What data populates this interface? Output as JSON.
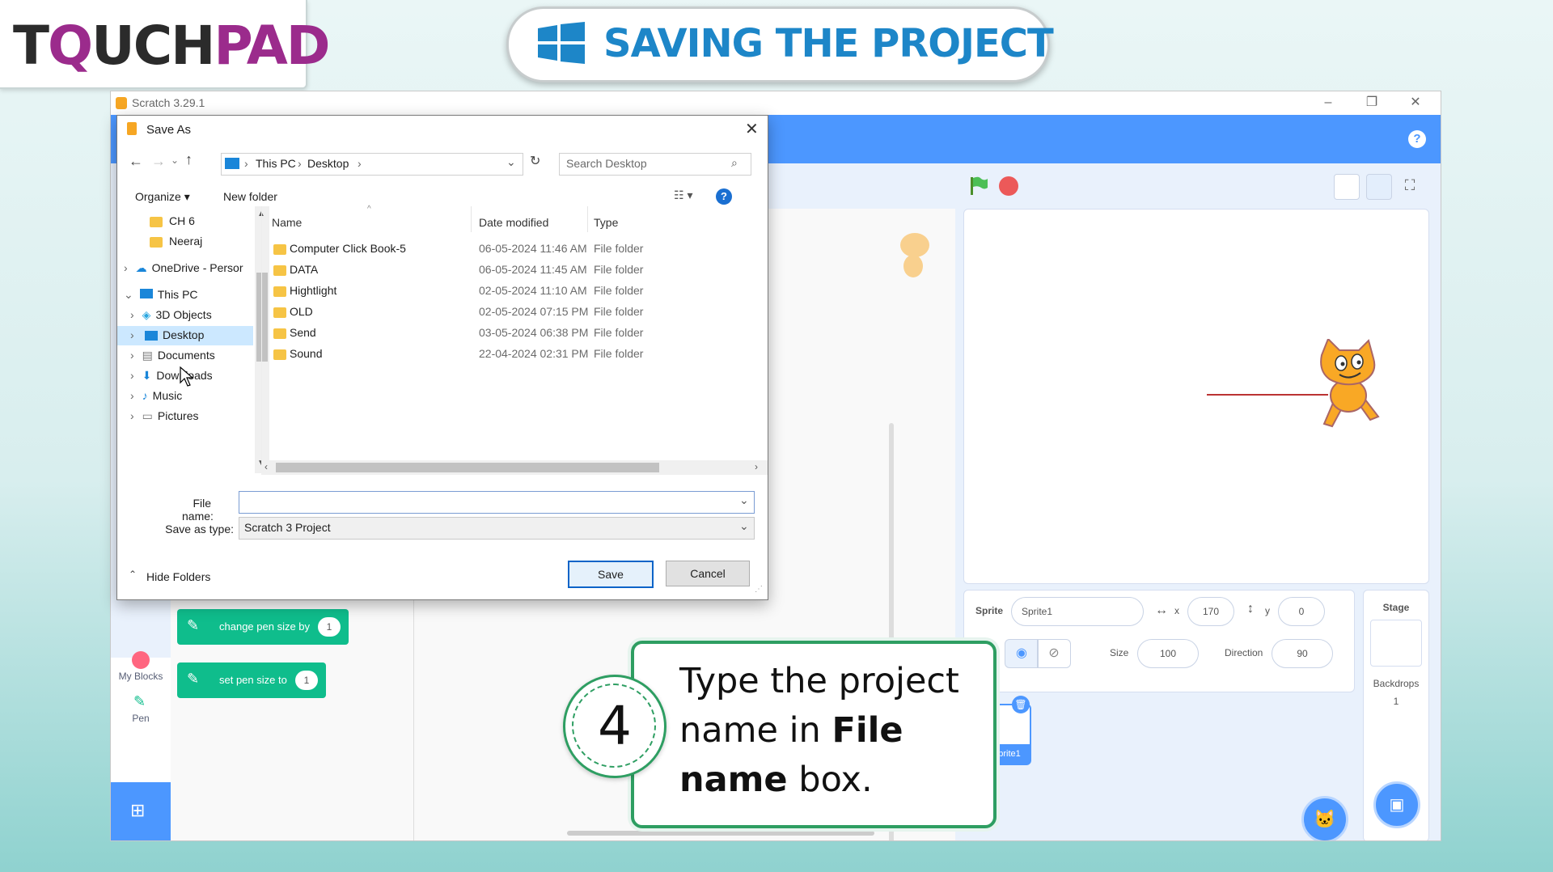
{
  "logo": {
    "part1": "T",
    "part2": "Q",
    "part3": "UCH",
    "part4": "PAD"
  },
  "title": "SAVING THE PROJECT",
  "scratch": {
    "window_title": "Scratch 3.29.1",
    "categories": [
      {
        "label": "My Blocks"
      },
      {
        "label": "Pen"
      }
    ],
    "blocks": [
      {
        "label": "change pen size by",
        "value": "1"
      },
      {
        "label": "set pen size to",
        "value": "1"
      }
    ],
    "sprite_panel": {
      "sprite_label": "Sprite",
      "sprite_name": "Sprite1",
      "x_label": "x",
      "x_value": "170",
      "y_label": "y",
      "y_value": "0",
      "show_label": "w",
      "size_label": "Size",
      "size_value": "100",
      "direction_label": "Direction",
      "direction_value": "90",
      "thumbnail_label": "prite1"
    },
    "stage_panel": {
      "title": "Stage",
      "backdrops_label": "Backdrops",
      "backdrops_count": "1"
    }
  },
  "dialog": {
    "title": "Save As",
    "breadcrumb": [
      "This PC",
      "Desktop"
    ],
    "search_placeholder": "Search Desktop",
    "toolbar": {
      "organize": "Organize ▾",
      "new_folder": "New folder"
    },
    "nav": [
      {
        "label": "CH 6",
        "type": "folder"
      },
      {
        "label": "Neeraj",
        "type": "folder"
      },
      {
        "label": "OneDrive - Persor",
        "type": "cloud"
      },
      {
        "label": "This PC",
        "type": "pc"
      },
      {
        "label": "3D Objects",
        "type": "3d"
      },
      {
        "label": "Desktop",
        "type": "desktop"
      },
      {
        "label": "Documents",
        "type": "docs"
      },
      {
        "label": "Downloads",
        "type": "down"
      },
      {
        "label": "Music",
        "type": "music"
      },
      {
        "label": "Pictures",
        "type": "pics"
      }
    ],
    "columns": {
      "name": "Name",
      "date": "Date modified",
      "type": "Type"
    },
    "files": [
      {
        "name": "Computer Click Book-5",
        "date": "06-05-2024 11:46 AM",
        "type": "File folder"
      },
      {
        "name": "DATA",
        "date": "06-05-2024 11:45 AM",
        "type": "File folder"
      },
      {
        "name": "Hightlight",
        "date": "02-05-2024 11:10 AM",
        "type": "File folder"
      },
      {
        "name": "OLD",
        "date": "02-05-2024 07:15 PM",
        "type": "File folder"
      },
      {
        "name": "Send",
        "date": "03-05-2024 06:38 PM",
        "type": "File folder"
      },
      {
        "name": "Sound",
        "date": "22-04-2024 02:31 PM",
        "type": "File folder"
      }
    ],
    "file_name_label": "File name:",
    "file_name_value": "",
    "save_type_label": "Save as type:",
    "save_type_value": "Scratch 3 Project",
    "hide_folders": "Hide Folders",
    "save": "Save",
    "cancel": "Cancel"
  },
  "callout": {
    "step": "4",
    "text_before": "Type the project name in ",
    "text_bold": "File name",
    "text_after": " box."
  }
}
